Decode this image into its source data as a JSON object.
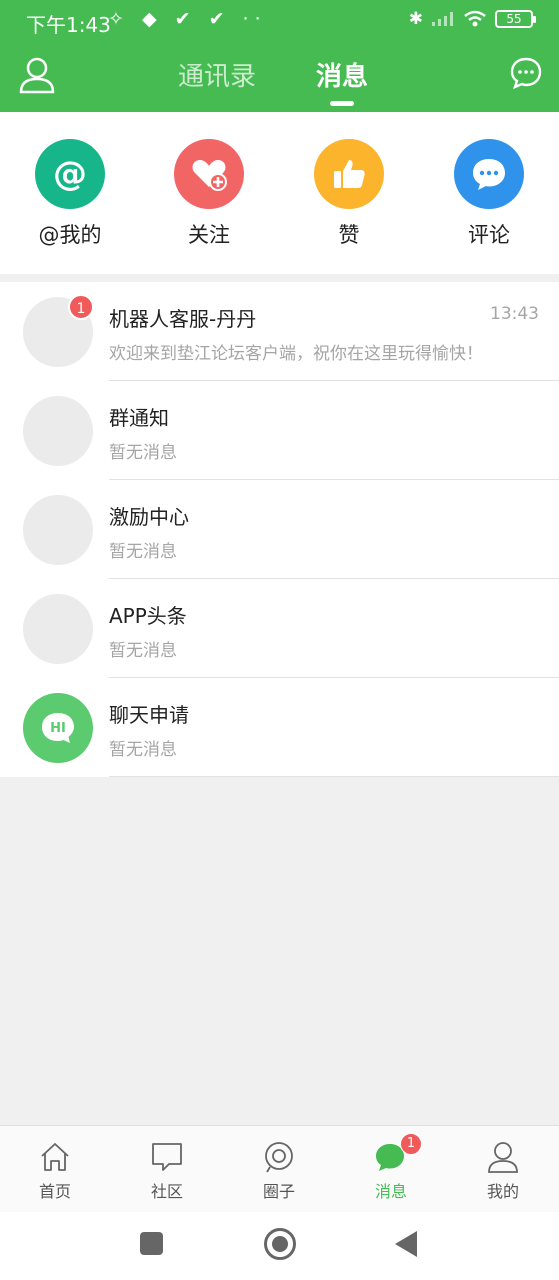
{
  "statusbar": {
    "time": "下午1:43",
    "glyphs": "✧ ◆ ✔ ✔ ··",
    "battery": "55"
  },
  "header": {
    "tabs": [
      {
        "label": "通讯录",
        "active": false
      },
      {
        "label": "消息",
        "active": true
      }
    ]
  },
  "quick_actions": [
    {
      "label": "@我的",
      "icon": "at-icon",
      "color": "#17b68a"
    },
    {
      "label": "关注",
      "icon": "heart-plus-icon",
      "color": "#f26565"
    },
    {
      "label": "赞",
      "icon": "thumbs-up-icon",
      "color": "#fbb42c"
    },
    {
      "label": "评论",
      "icon": "comment-icon",
      "color": "#2f93eb"
    }
  ],
  "messages": [
    {
      "title": "机器人客服-丹丹",
      "subtitle": "欢迎来到垫江论坛客户端，祝你在这里玩得愉快！",
      "time": "13:43",
      "badge": "1"
    },
    {
      "title": "群通知",
      "subtitle": "暂无消息"
    },
    {
      "title": "激励中心",
      "subtitle": "暂无消息"
    },
    {
      "title": "APP头条",
      "subtitle": "暂无消息"
    },
    {
      "title": "聊天申请",
      "subtitle": "暂无消息",
      "avatar_text": "HI"
    }
  ],
  "bottom_nav": [
    {
      "label": "首页",
      "icon": "home-icon"
    },
    {
      "label": "社区",
      "icon": "community-icon"
    },
    {
      "label": "圈子",
      "icon": "circle-icon"
    },
    {
      "label": "消息",
      "icon": "message-icon",
      "active": true,
      "badge": "1"
    },
    {
      "label": "我的",
      "icon": "profile-icon"
    }
  ],
  "colors": {
    "primary": "#45bb52",
    "badge": "#f15a5a"
  }
}
